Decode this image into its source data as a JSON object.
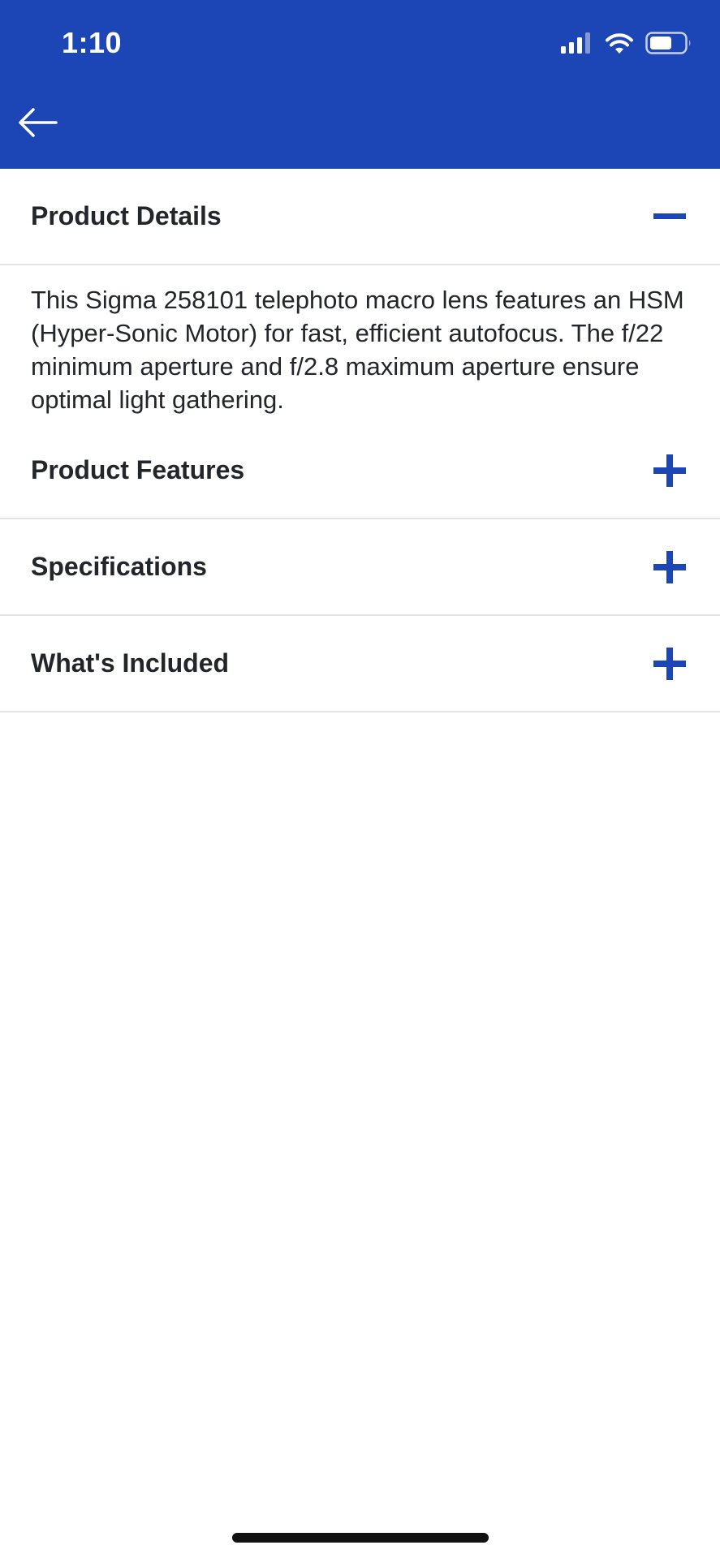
{
  "status_bar": {
    "time": "1:10"
  },
  "nav": {
    "back_icon": "arrow-left-icon"
  },
  "accordion": [
    {
      "title": "Product Details",
      "expanded": true,
      "toggle_icon": "minus-icon",
      "body": "This Sigma 258101 telephoto macro lens features an HSM (Hyper-Sonic Motor) for fast, efficient autofocus. The f/22 minimum aperture and f/2.8 maximum aperture ensure optimal light gathering."
    },
    {
      "title": "Product Features",
      "expanded": false,
      "toggle_icon": "plus-icon"
    },
    {
      "title": "Specifications",
      "expanded": false,
      "toggle_icon": "plus-icon"
    },
    {
      "title": "What's Included",
      "expanded": false,
      "toggle_icon": "plus-icon"
    }
  ],
  "colors": {
    "brand_blue": "#1c45b5",
    "text": "#22252b",
    "divider": "#e2e3e6"
  }
}
